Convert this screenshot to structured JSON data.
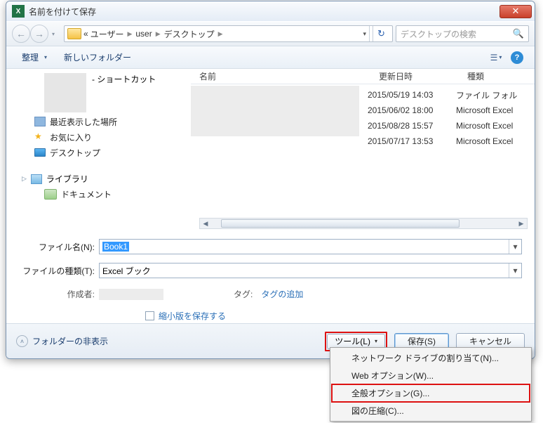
{
  "app_icon_text": "X",
  "title": "名前を付けて保存",
  "breadcrumb": {
    "prefix": "«",
    "parts": [
      "ユーザー",
      "user",
      "デスクトップ"
    ]
  },
  "search": {
    "placeholder": "デスクトップの検索"
  },
  "toolbar": {
    "organize": "整理",
    "new_folder": "新しいフォルダー"
  },
  "sidebar": {
    "shortcut_suffix": " - ショートカット",
    "recent": "最近表示した場所",
    "favorites": "お気に入り",
    "desktop": "デスクトップ",
    "libraries": "ライブラリ",
    "documents": "ドキュメント"
  },
  "columns": {
    "name": "名前",
    "date": "更新日時",
    "kind": "種類"
  },
  "files": [
    {
      "date": "2015/05/19 14:03",
      "kind": "ファイル フォル"
    },
    {
      "date": "2015/06/02 18:00",
      "kind": "Microsoft Excel"
    },
    {
      "date": "2015/08/28 15:57",
      "kind": "Microsoft Excel"
    },
    {
      "date": "2015/07/17 13:53",
      "kind": "Microsoft Excel"
    }
  ],
  "form": {
    "filename_label": "ファイル名(N):",
    "filename_value": "Book1",
    "filetype_label": "ファイルの種類(T):",
    "filetype_value": "Excel ブック",
    "author_label": "作成者:",
    "tag_label": "タグ:",
    "tag_add": "タグの追加",
    "save_thumb": "縮小版を保存する"
  },
  "footer": {
    "hide_folders": "フォルダーの非表示",
    "tools": "ツール(L)",
    "save": "保存(S)",
    "cancel": "キャンセル"
  },
  "menu": {
    "map_drive": "ネットワーク ドライブの割り当て(N)...",
    "web_options": "Web オプション(W)...",
    "general_options": "全般オプション(G)...",
    "compress": "図の圧縮(C)..."
  }
}
